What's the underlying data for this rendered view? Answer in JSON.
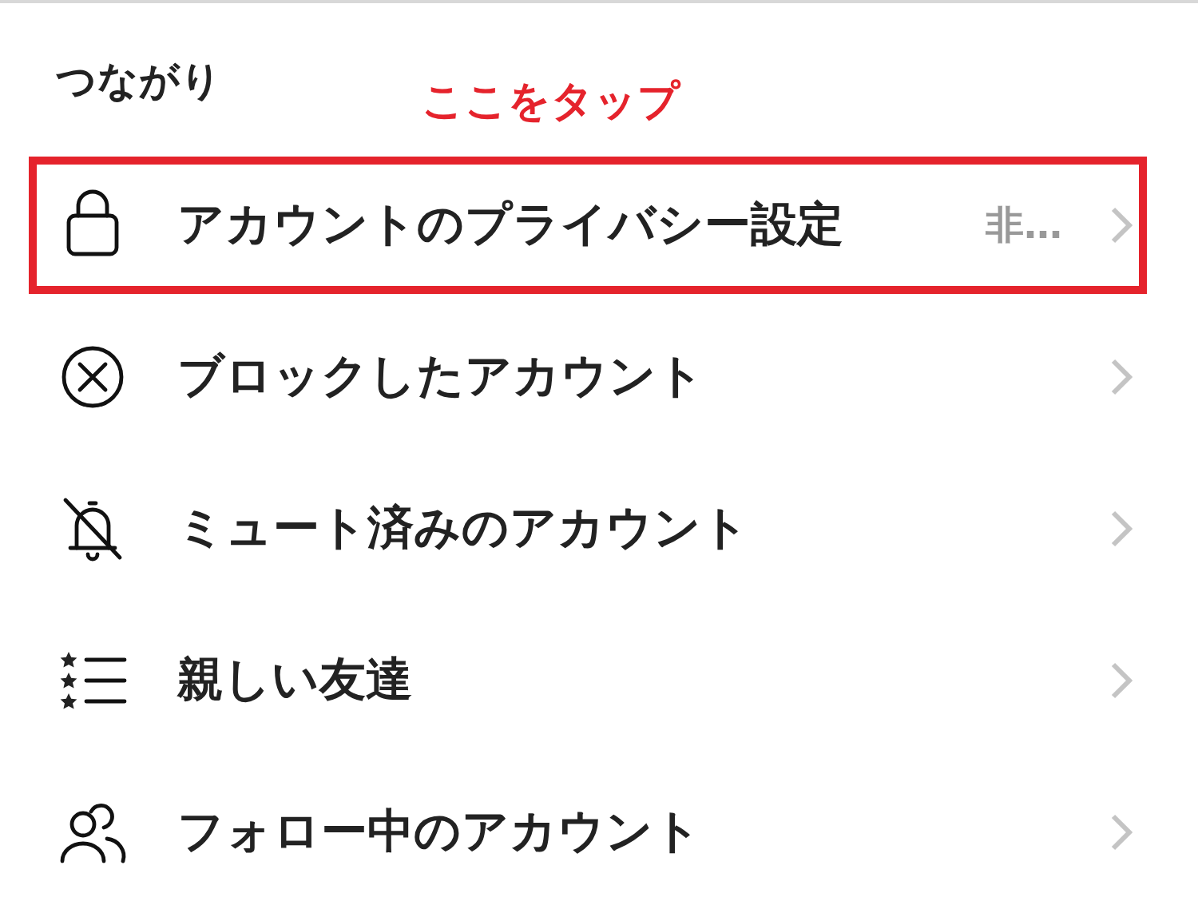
{
  "section": {
    "title": "つながり"
  },
  "annotation": {
    "text": "ここをタップ"
  },
  "items": [
    {
      "kind": "lock",
      "label": "アカウントのプライバシー設定",
      "value": "非…",
      "highlighted": true
    },
    {
      "kind": "block",
      "label": "ブロックしたアカウント",
      "highlighted": false
    },
    {
      "kind": "mute",
      "label": "ミュート済みのアカウント",
      "highlighted": false
    },
    {
      "kind": "friends",
      "label": "親しい友達",
      "highlighted": false
    },
    {
      "kind": "following",
      "label": "フォロー中のアカウント",
      "highlighted": false
    }
  ]
}
